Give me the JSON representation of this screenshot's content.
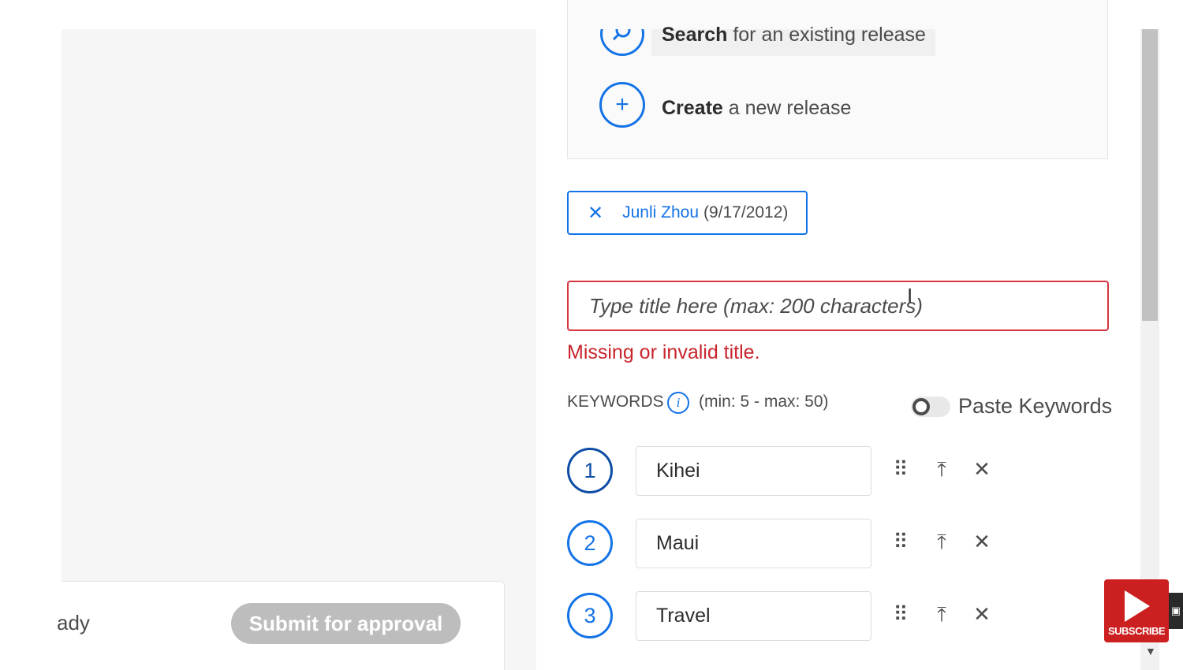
{
  "footer": {
    "status_text": "ady",
    "submit_label": "Submit for approval"
  },
  "release": {
    "search_bold": "Search",
    "search_rest": " for an existing release",
    "create_bold": "Create",
    "create_rest": " a new release",
    "create_symbol": "+"
  },
  "tag": {
    "remove_symbol": "✕",
    "name": "Junli Zhou",
    "date": "(9/17/2012)"
  },
  "title_field": {
    "placeholder": "Type title here (max: 200 characters)",
    "value": "",
    "error": "Missing or invalid title."
  },
  "keywords": {
    "label": "KEYWORDS",
    "info_symbol": "i",
    "range": "(min: 5 - max: 50)",
    "paste_label": "Paste Keywords",
    "paste_enabled": false,
    "items": [
      {
        "num": "1",
        "value": "Kihei"
      },
      {
        "num": "2",
        "value": "Maui"
      },
      {
        "num": "3",
        "value": "Travel"
      }
    ],
    "drag_symbol": "⠿",
    "top_symbol": "⤒",
    "remove_symbol": "✕"
  },
  "overlay": {
    "subscribe_label": "SUBSCRIBE"
  },
  "colors": {
    "accent": "#1473e6",
    "error": "#d7373f",
    "subscribe": "#cc1f1f"
  }
}
